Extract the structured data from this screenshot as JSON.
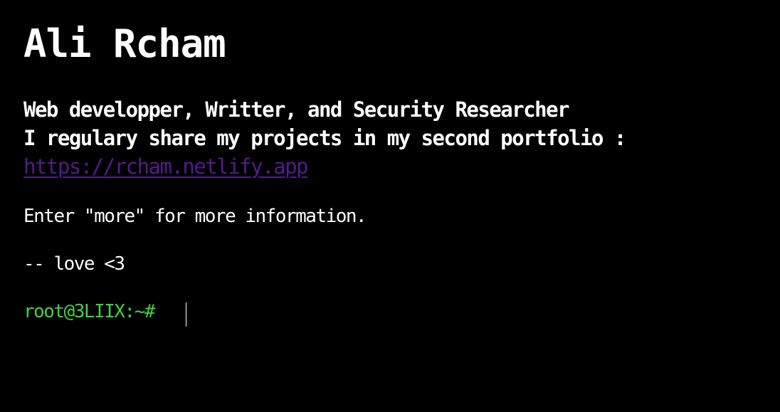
{
  "header": {
    "name": "Ali Rcham"
  },
  "bio": {
    "line1": "Web developper, Writter, and Security Researcher",
    "line2": "I regulary share my projects in my second portfolio :",
    "link_text": "https://rcham.netlify.app"
  },
  "messages": {
    "more_hint": "Enter \"more\" for more information.",
    "signoff": "-- love <3"
  },
  "prompt": {
    "label": "root@3LIIX:~#",
    "value": ""
  },
  "colors": {
    "background": "#000000",
    "text": "#ffffff",
    "link": "#551a8b",
    "prompt": "#3fd13f"
  }
}
